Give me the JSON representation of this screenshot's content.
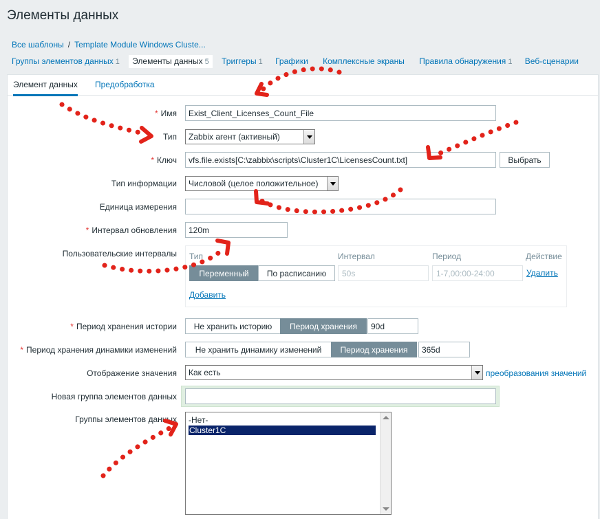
{
  "page": {
    "title": "Элементы данных"
  },
  "breadcrumbs": {
    "all_templates": "Все шаблоны",
    "separator": "/",
    "template": "Template Module Windows Cluste..."
  },
  "nav": [
    {
      "label": "Группы элементов данных",
      "count": "1"
    },
    {
      "label": "Элементы данных",
      "count": "5"
    },
    {
      "label": "Триггеры",
      "count": "1"
    },
    {
      "label": "Графики",
      "count": ""
    },
    {
      "label": "Комплексные экраны",
      "count": ""
    },
    {
      "label": "Правила обнаружения",
      "count": "1"
    },
    {
      "label": "Веб-сценарии",
      "count": ""
    }
  ],
  "tabs": {
    "item": "Элемент данных",
    "preprocessing": "Предобработка"
  },
  "form": {
    "required_mark": "*",
    "name": {
      "label": "Имя",
      "value": "Exist_Client_Licenses_Count_File"
    },
    "type": {
      "label": "Тип",
      "value": "Zabbix агент (активный)"
    },
    "key": {
      "label": "Ключ",
      "value": "vfs.file.exists[C:\\zabbix\\scripts\\Cluster1C\\LicensesCount.txt]",
      "select_button": "Выбрать"
    },
    "info_type": {
      "label": "Тип информации",
      "value": "Числовой (целое положительное)"
    },
    "units": {
      "label": "Единица измерения",
      "value": ""
    },
    "update_interval": {
      "label": "Интервал обновления",
      "value": "120m"
    },
    "custom_intervals": {
      "label": "Пользовательские интервалы",
      "headers": {
        "type": "Тип",
        "interval": "Интервал",
        "period": "Период",
        "action": "Действие"
      },
      "type_flexible": "Переменный",
      "type_scheduling": "По расписанию",
      "interval_placeholder": "50s",
      "period_placeholder": "1-7,00:00-24:00",
      "remove": "Удалить",
      "add": "Добавить"
    },
    "history": {
      "label": "Период хранения истории",
      "no_keep": "Не хранить историю",
      "keep": "Период хранения",
      "value": "90d"
    },
    "trends": {
      "label": "Период хранения динамики изменений",
      "no_keep": "Не хранить динамику изменений",
      "keep": "Период хранения",
      "value": "365d"
    },
    "valuemap": {
      "label": "Отображение значения",
      "value": "Как есть",
      "link": "преобразования значений"
    },
    "new_application": {
      "label": "Новая группа элементов данных",
      "value": ""
    },
    "applications": {
      "label": "Группы элементов данных",
      "options": [
        "-Нет-",
        "Cluster1C"
      ],
      "selected": "Cluster1C"
    }
  },
  "colors": {
    "link": "#0275b8",
    "required": "#e33734",
    "annotation": "#e2231a",
    "active_toggle": "#768d99"
  }
}
